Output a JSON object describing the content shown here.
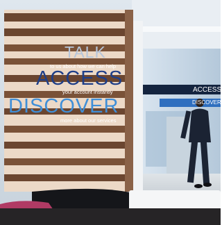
{
  "wall": {
    "talk": "TALK",
    "talk_sub": "to us about how we can help",
    "access": "ACCESS",
    "access_sub": "your account instantly",
    "discover": "DISCOVER",
    "discover_sub": "more about our services"
  },
  "signs": {
    "access": "ACCESS",
    "discover": "DISCOVER"
  },
  "colors": {
    "talk": "#b7c6da",
    "access": "#1f3f88",
    "discover": "#3f8fd8",
    "wood": "#6b4630",
    "sign_bar": "#14243f"
  }
}
